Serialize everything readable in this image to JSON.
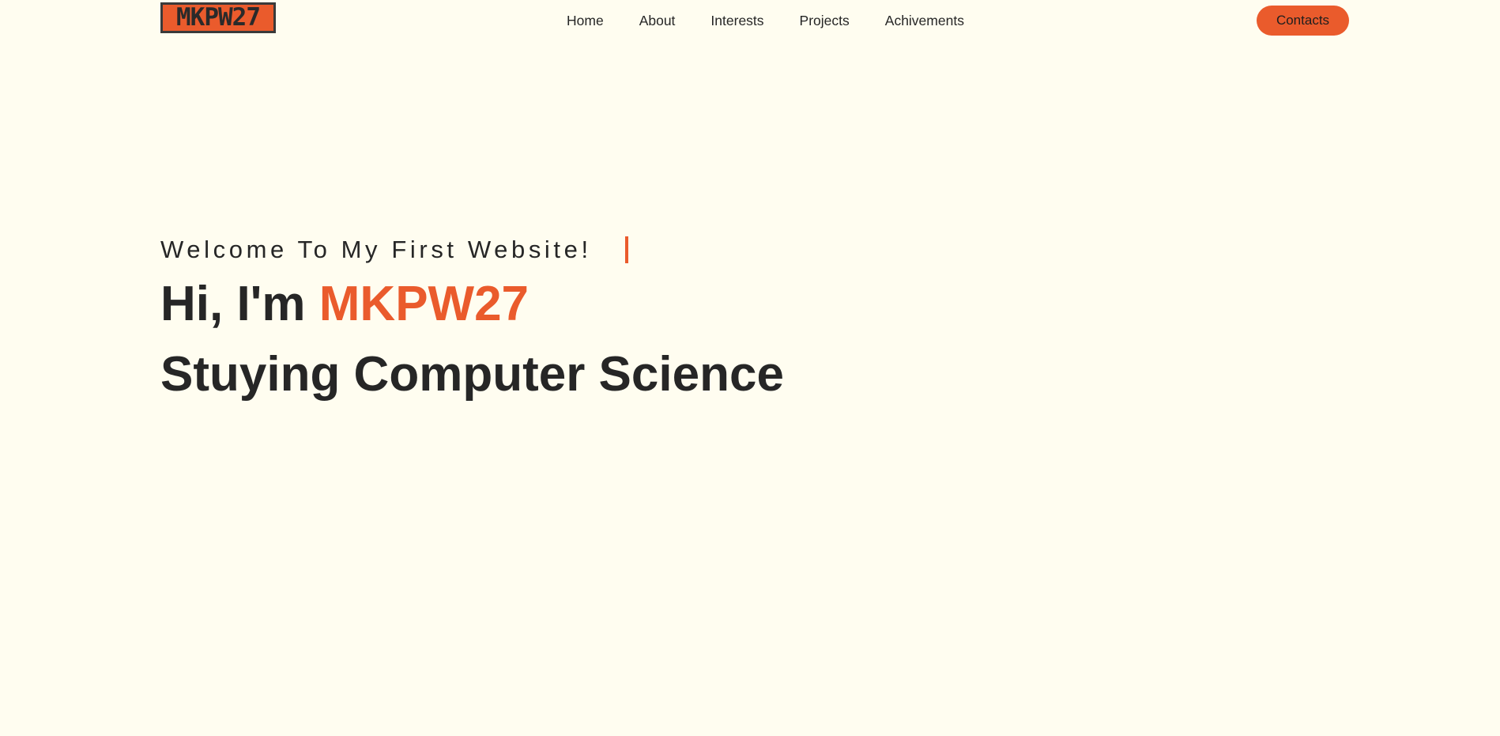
{
  "brand": {
    "logo_text": "MKPW27"
  },
  "nav": {
    "items": [
      {
        "label": "Home"
      },
      {
        "label": "About"
      },
      {
        "label": "Interests"
      },
      {
        "label": "Projects"
      },
      {
        "label": "Achivements"
      }
    ],
    "contacts_label": "Contacts"
  },
  "hero": {
    "welcome": "Welcome To My First Website!",
    "greeting_prefix": "Hi, I'm ",
    "name": "MKPW27",
    "subtitle": "Stuying Computer Science"
  },
  "colors": {
    "background": "#fffdf0",
    "accent": "#ea5b2c",
    "text": "#262626"
  }
}
